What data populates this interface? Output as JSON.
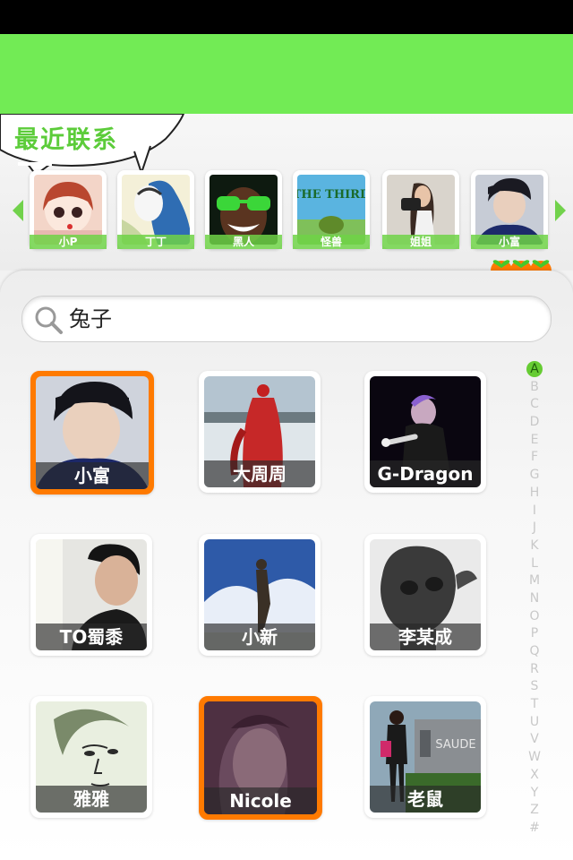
{
  "recent": {
    "title": "最近联系",
    "items": [
      {
        "label": "小P"
      },
      {
        "label": "丁丁"
      },
      {
        "label": "黑人"
      },
      {
        "label": "怪兽",
        "poster_text": "THE THIRD"
      },
      {
        "label": "姐姐"
      },
      {
        "label": "小富"
      }
    ]
  },
  "search": {
    "value": "兔子"
  },
  "contacts": [
    {
      "name": "小富",
      "selected": true
    },
    {
      "name": "大周周",
      "selected": false
    },
    {
      "name": "G-Dragon",
      "selected": false
    },
    {
      "name": "TO蜀黍",
      "selected": false
    },
    {
      "name": "小新",
      "selected": false
    },
    {
      "name": "李某成",
      "selected": false
    },
    {
      "name": "雅雅",
      "selected": false
    },
    {
      "name": "Nicole",
      "selected": true
    },
    {
      "name": "老鼠",
      "selected": false
    }
  ],
  "alpha_index": [
    "A",
    "B",
    "C",
    "D",
    "E",
    "F",
    "G",
    "H",
    "I",
    "J",
    "K",
    "L",
    "M",
    "N",
    "O",
    "P",
    "Q",
    "R",
    "S",
    "T",
    "U",
    "V",
    "W",
    "X",
    "Y",
    "Z",
    "#"
  ],
  "alpha_active": "A",
  "colors": {
    "header_green": "#72eb55",
    "selection_orange": "#ff7a00",
    "accent_green": "#5ccc3a"
  },
  "icons": [
    "arrow-left-icon",
    "arrow-right-icon",
    "search-icon",
    "heart-icon"
  ]
}
